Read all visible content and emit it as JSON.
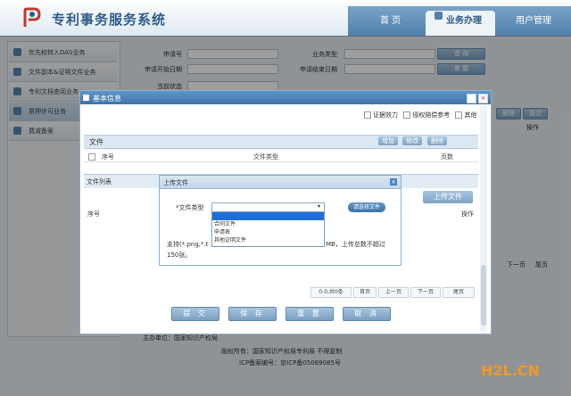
{
  "header": {
    "app_title": "专利事务服务系统",
    "nav": [
      {
        "label": "首 页"
      },
      {
        "label": "业务办理"
      },
      {
        "label": "用户管理"
      }
    ]
  },
  "sidebar": {
    "items": [
      {
        "label": "优先权转入DAS业务"
      },
      {
        "label": "文件副本&证明文件业务"
      },
      {
        "label": "专利文档查阅业务"
      },
      {
        "label": "质押许可业务"
      },
      {
        "label": "费减备案"
      }
    ]
  },
  "search_form": {
    "application_no_label": "申请号",
    "business_type_label": "业务类型",
    "start_date_label": "申请开始日期",
    "end_date_label": "申请结束日期",
    "status_label": "当前状态",
    "query_button": "查 询",
    "reset_button": "重 置"
  },
  "background_list": {
    "actions_label": "操作",
    "delete_button": "删除",
    "submit_button": "提交",
    "pager": [
      "下一页",
      "尾页"
    ]
  },
  "footer": {
    "line1": "主办单位：国家知识产权局",
    "line2": "版权所有：国家知识产权局专利局 不得复制",
    "icp": "ICP备案编号：京ICP备05069085号"
  },
  "dialog": {
    "title": "基本信息",
    "checkboxes": [
      "证据效力",
      "侵权赔偿参考",
      "其他"
    ],
    "files_section": {
      "title": "文件",
      "buttons": [
        "增加",
        "修改",
        "删除"
      ],
      "columns": [
        "序号",
        "文件类型",
        "页数"
      ]
    },
    "file_list": {
      "title": "文件列表",
      "upload_button": "上传文件",
      "columns": [
        "序号",
        "操作"
      ]
    },
    "pagination": {
      "summary": "0-0,共0条",
      "first": "首页",
      "prev": "上一页",
      "next": "下一页",
      "last": "尾页"
    },
    "footer_buttons": [
      "提 交",
      "保 存",
      "重 置",
      "取 消"
    ]
  },
  "upload_dialog": {
    "title": "上传文件",
    "file_type_label": "*文件类型",
    "choose_file_button": "请选择文件",
    "options": [
      "",
      "合同文件",
      "申请表",
      "其他证明文件"
    ],
    "selected_index": 0,
    "hint_left": "支持(*.png,*.t",
    "hint_right": "MB，上传总数不超过",
    "hint_line2": "150张。"
  },
  "watermark": "H2L.CN",
  "colors": {
    "primary": "#3d73a8",
    "header_bg": "#dfe9f2",
    "watermark": "#f29a1f"
  }
}
